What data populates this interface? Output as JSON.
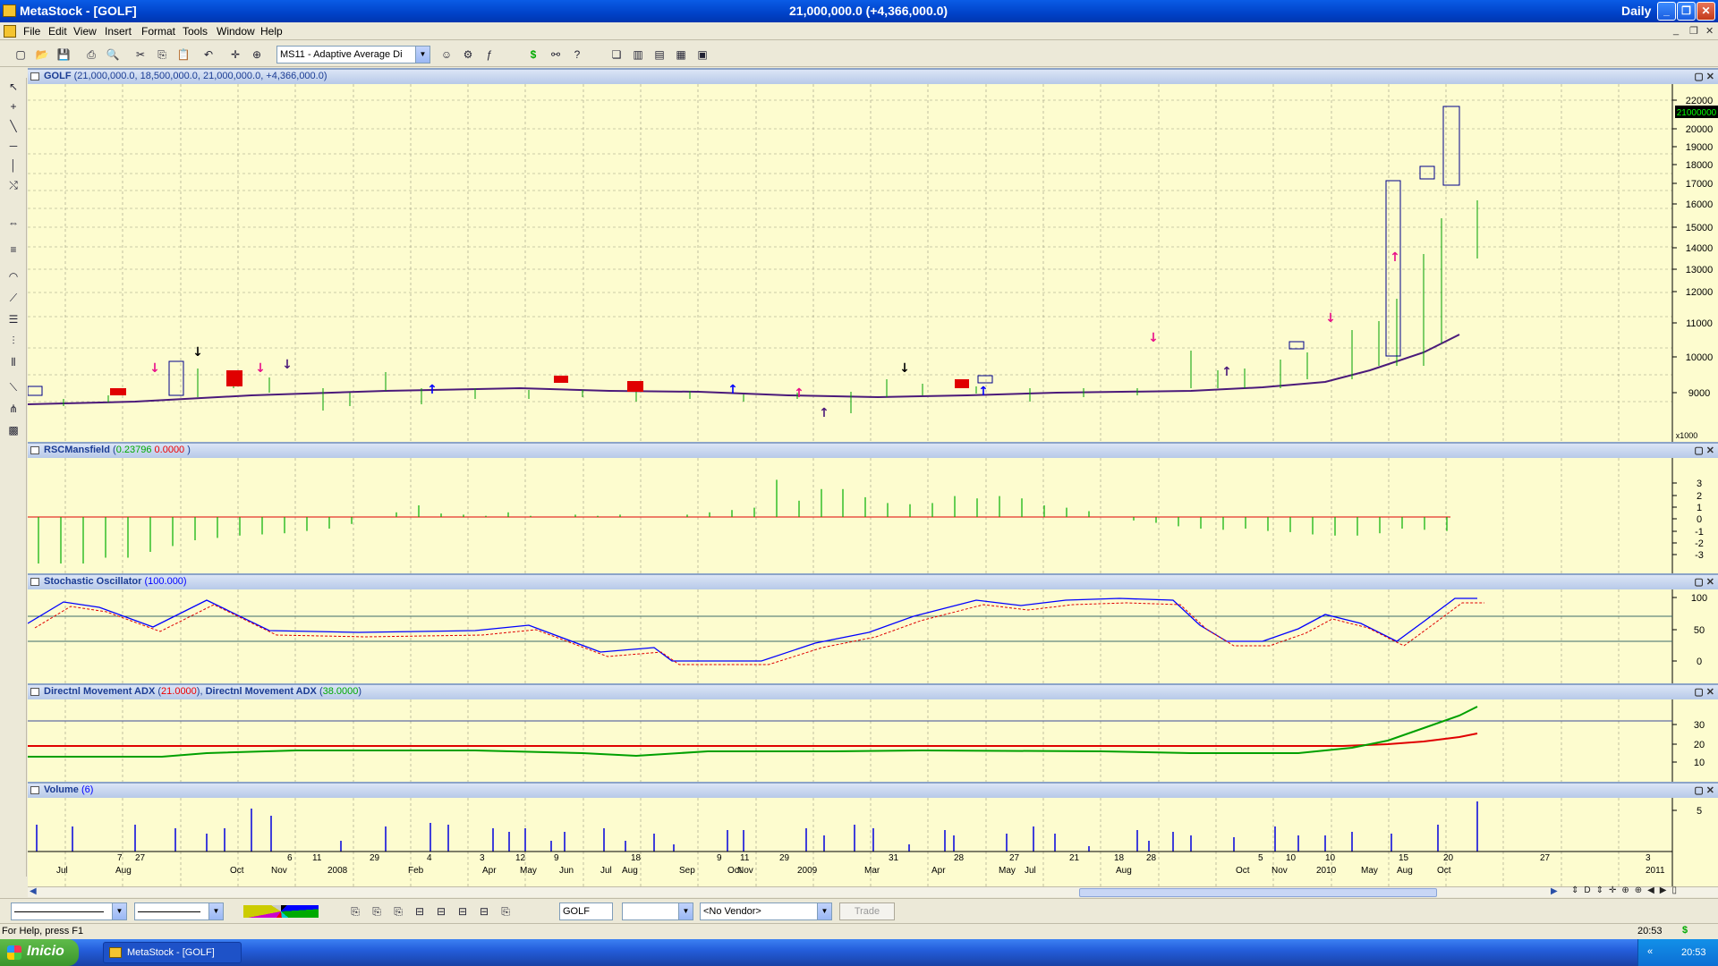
{
  "window": {
    "title": "MetaStock - [GOLF]",
    "header_value": "21,000,000.0 (+4,366,000.0)",
    "period": "Daily",
    "buttons": [
      "_",
      "❐",
      "✕"
    ]
  },
  "menu": {
    "items": [
      "File",
      "Edit",
      "View",
      "Insert",
      "Format",
      "Tools",
      "Window",
      "Help"
    ],
    "doc_controls": [
      "_",
      "❐",
      "✕"
    ]
  },
  "toolbar": {
    "expert_combo": "MS11 - Adaptive Average Di"
  },
  "panes": {
    "price": {
      "name": "GOLF",
      "values": "(21,000,000.0, 18,500,000.0, 21,000,000.0, +4,366,000.0)",
      "axis_labels": [
        "22000",
        "21000000",
        "20000",
        "19000",
        "18000",
        "17000",
        "16000",
        "15000",
        "14000",
        "13000",
        "12000",
        "11000",
        "10000",
        "9000"
      ],
      "scale_note": "x1000"
    },
    "rsc": {
      "name": "RSCMansfield",
      "value_green": "0.23796",
      "value_red": "0.0000",
      "axis_labels": [
        "3",
        "2",
        "1",
        "0",
        "-1",
        "-2",
        "-3"
      ]
    },
    "stoch": {
      "name": "Stochastic Oscillator",
      "value": "(100.000)",
      "axis_labels": [
        "100",
        "50",
        "0"
      ]
    },
    "adx": {
      "name": "Directnl Movement ADX",
      "value_red": "21.0000",
      "name2": "Directnl Movement ADX",
      "value_green": "38.0000",
      "axis_labels": [
        "30",
        "20",
        "10"
      ]
    },
    "volume": {
      "name": "Volume",
      "value": "(6)",
      "axis_labels": [
        "5"
      ]
    }
  },
  "x_axis": {
    "day_labels": [
      "7",
      "27",
      "6",
      "11",
      "29",
      "4",
      "3",
      "12",
      "9",
      "18",
      "9",
      "11",
      "29",
      "31",
      "28",
      "27",
      "21",
      "18",
      "28",
      "5",
      "10",
      "10",
      "15",
      "20",
      "27",
      "3"
    ],
    "month_labels": [
      "Jul",
      "Aug",
      "Oct",
      "Nov",
      "2008",
      "Feb",
      "Apr",
      "May",
      "Jun",
      "Jul",
      "Aug",
      "Sep",
      "Oct",
      "Nov",
      "2009",
      "Mar",
      "Apr",
      "May",
      "Jul",
      "Aug",
      "Oct",
      "Nov",
      "2010",
      "May",
      "Aug",
      "Oct",
      "2011"
    ]
  },
  "bottom": {
    "security": "GOLF",
    "vendor": "<No Vendor>",
    "trade": "Trade"
  },
  "status": {
    "help": "For Help, press F1",
    "time": "20:53",
    "currency": "$"
  },
  "taskbar": {
    "start": "Inicio",
    "item": "MetaStock - [GOLF]",
    "clock": "20:53"
  },
  "colors": {
    "chart_bg": "#fdfccf",
    "pane_title": "#b7c9e8",
    "red": "#e00000",
    "green": "#00a000",
    "blue": "#0000ff",
    "purple": "#4b1a7a"
  }
}
